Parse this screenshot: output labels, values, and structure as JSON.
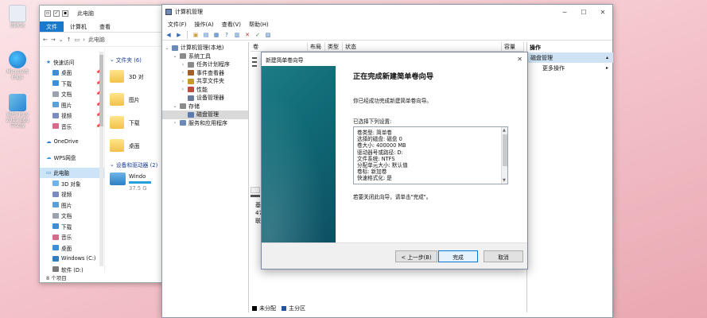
{
  "desktop": {
    "icons": [
      {
        "label": "回收站",
        "color": "#e9eef5"
      },
      {
        "label": "Microsoft Edge",
        "color": "#2b8ad8"
      },
      {
        "label": "WPS Plus 2019 Edu\n中文版",
        "color": "#4aa3df"
      }
    ]
  },
  "explorer": {
    "title": "此电脑",
    "tabs": [
      "文件",
      "计算机",
      "查看"
    ],
    "address": "此电脑",
    "quick_access_label": "快速访问",
    "quick_items": [
      {
        "label": "桌面",
        "color": "#3a8fd8"
      },
      {
        "label": "下载",
        "color": "#3a8fd8"
      },
      {
        "label": "文档",
        "color": "#9aa3ad"
      },
      {
        "label": "图片",
        "color": "#5aa0d8"
      },
      {
        "label": "视频",
        "color": "#7b8bc0"
      },
      {
        "label": "音乐",
        "color": "#d86a8a"
      }
    ],
    "onedrive_label": "OneDrive",
    "wps_label": "WPS网盘",
    "this_pc_label": "此电脑",
    "pc_items": [
      {
        "label": "3D 对象",
        "color": "#6fb4e9"
      },
      {
        "label": "视频",
        "color": "#7b8bc0"
      },
      {
        "label": "图片",
        "color": "#5aa0d8"
      },
      {
        "label": "文档",
        "color": "#9aa3ad"
      },
      {
        "label": "下载",
        "color": "#3a8fd8"
      },
      {
        "label": "音乐",
        "color": "#d86a8a"
      },
      {
        "label": "桌面",
        "color": "#3a8fd8"
      },
      {
        "label": "Windows (C:)",
        "color": "#2c7fc3"
      },
      {
        "label": "软件 (D:)",
        "color": "#7a7a7a"
      }
    ],
    "folders_header": "文件夹 (6)",
    "folders": [
      "3D 对",
      "图片",
      "下载",
      "桌面"
    ],
    "devices_header": "设备和驱动器 (2)",
    "drive_name": "Windo",
    "drive_sub": "37.5 G",
    "status": "8 个项目"
  },
  "mgmt": {
    "title": "计算机管理(本地)",
    "window_title": "计算机管理",
    "menu": [
      "文件(F)",
      "操作(A)",
      "查看(V)",
      "帮助(H)"
    ],
    "tree": [
      {
        "label": "计算机管理(本地)",
        "level": 0,
        "expander": "⌄"
      },
      {
        "label": "系统工具",
        "level": 1,
        "expander": "⌄"
      },
      {
        "label": "任务计划程序",
        "level": 2,
        "expander": "›"
      },
      {
        "label": "事件查看器",
        "level": 2,
        "expander": "›"
      },
      {
        "label": "共享文件夹",
        "level": 2,
        "expander": "›"
      },
      {
        "label": "性能",
        "level": 2,
        "expander": "›"
      },
      {
        "label": "设备管理器",
        "level": 2,
        "expander": ""
      },
      {
        "label": "存储",
        "level": 1,
        "expander": "⌄"
      },
      {
        "label": "磁盘管理",
        "level": 2,
        "expander": "",
        "selected": true
      },
      {
        "label": "服务和应用程序",
        "level": 1,
        "expander": "›"
      }
    ],
    "columns": [
      "卷",
      "布局",
      "类型",
      "状态",
      "容量"
    ],
    "disk_lines": [
      "基",
      "47",
      "联"
    ],
    "legend": [
      {
        "label": "未分配",
        "color": "#000000"
      },
      {
        "label": "主分区",
        "color": "#2352a6"
      }
    ],
    "actions_header": "操作",
    "actions_selected": "磁盘管理",
    "actions_more": "更多操作"
  },
  "wizard": {
    "title": "新建简单卷向导",
    "heading": "正在完成新建简单卷向导",
    "intro": "你已经成功完成新建简单卷向导。",
    "settings_label": "已选择下列设置:",
    "settings": [
      "卷类型: 简单卷",
      "选择的磁盘: 磁盘 0",
      "卷大小: 400000 MB",
      "驱动器号或路径: D:",
      "文件系统: NTFS",
      "分配单元大小: 默认值",
      "卷标: 新加卷",
      "快速格式化: 是"
    ],
    "close_hint": "若要关闭此向导，请单击\"完成\"。",
    "back_button": "< 上一步(B)",
    "finish_button": "完成",
    "cancel_button": "取消"
  }
}
